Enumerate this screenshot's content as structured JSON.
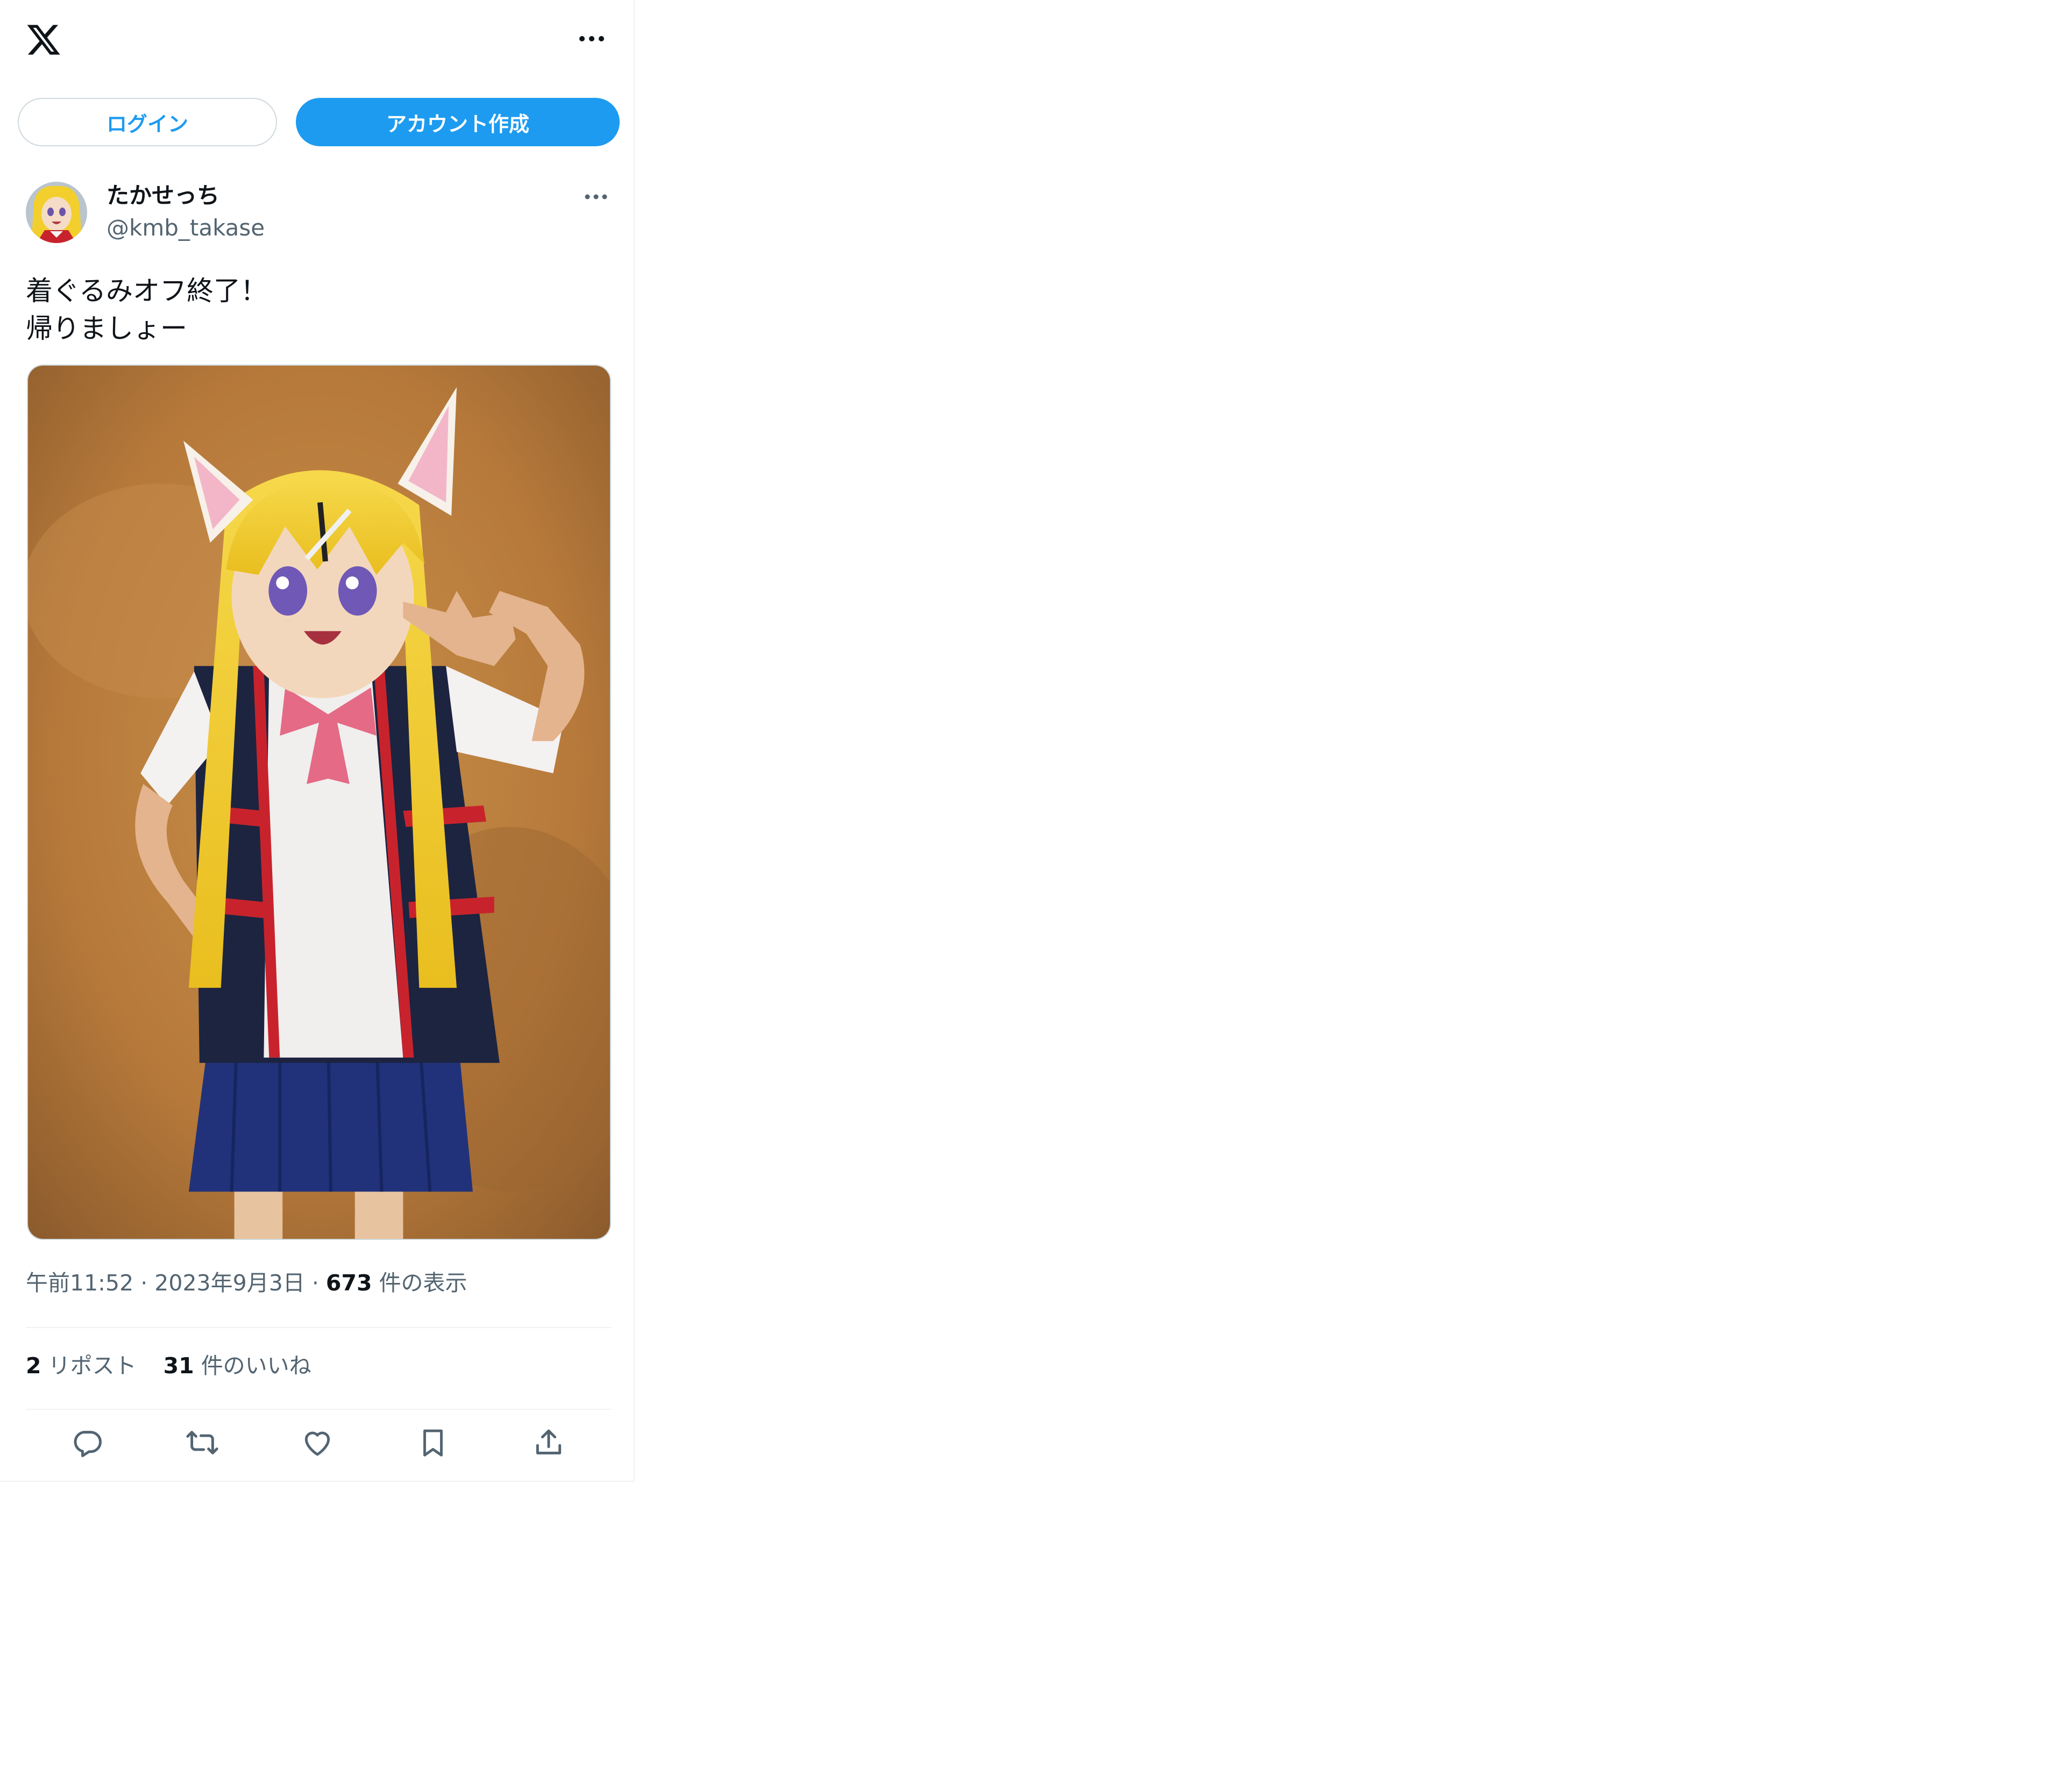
{
  "topbar": {
    "logo_icon": "x-logo-icon",
    "more_icon": "more-horizontal-icon"
  },
  "auth": {
    "login_label": "ログイン",
    "signup_label": "アカウント作成"
  },
  "tweet": {
    "author_name": "たかせっち",
    "author_handle": "@kmb_takase",
    "text": "着ぐるみオフ終了！\n帰りましょー",
    "time": "午前11:52",
    "date": "2023年9月3日",
    "views_count": "673",
    "views_label": "件の表示",
    "reposts_count": "2",
    "reposts_label": "リポスト",
    "likes_count": "31",
    "likes_label": "件のいいね"
  },
  "actions": [
    "reply-icon",
    "repost-icon",
    "like-icon",
    "bookmark-icon",
    "share-icon"
  ],
  "colors": {
    "accent": "#1d9bf0",
    "text": "#0f1419",
    "secondary": "#536471",
    "border": "#cfd9de"
  }
}
